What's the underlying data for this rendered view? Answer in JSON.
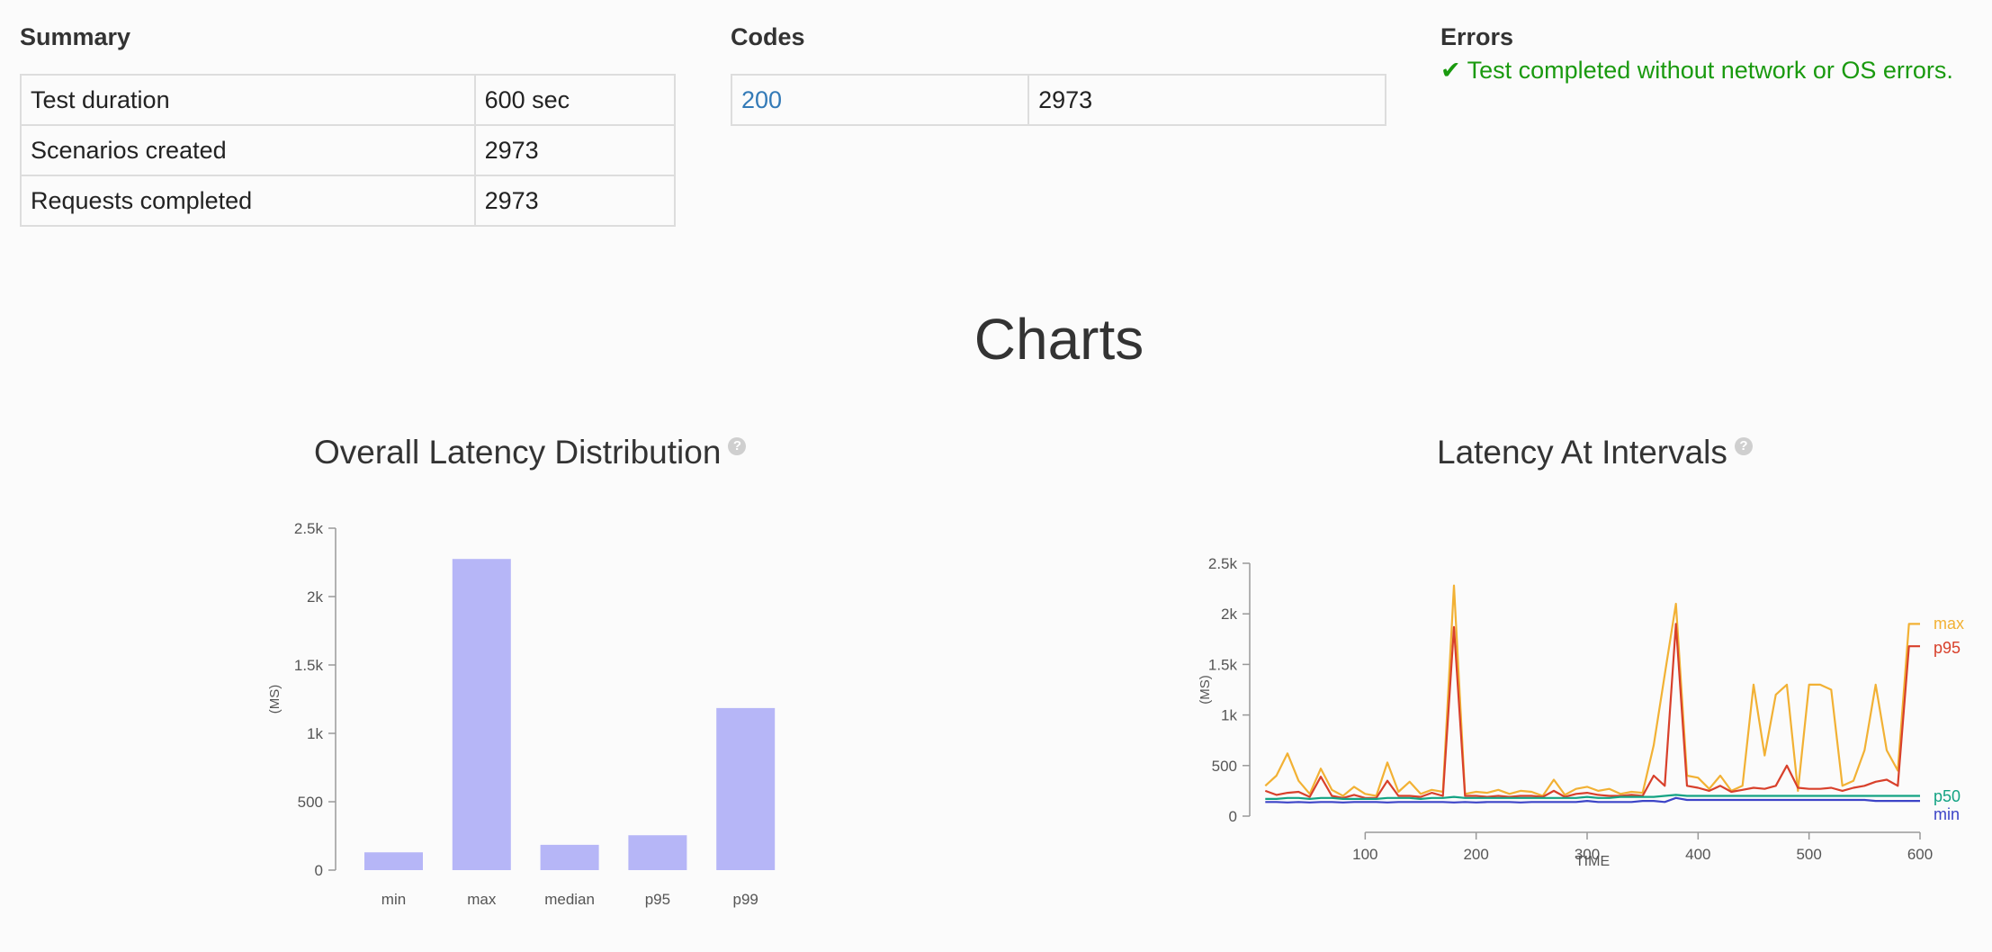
{
  "summary": {
    "heading": "Summary",
    "rows": [
      {
        "label": "Test duration",
        "value": "600 sec"
      },
      {
        "label": "Scenarios created",
        "value": "2973"
      },
      {
        "label": "Requests completed",
        "value": "2973"
      }
    ]
  },
  "codes": {
    "heading": "Codes",
    "rows": [
      {
        "code": "200",
        "count": "2973"
      }
    ]
  },
  "errors": {
    "heading": "Errors",
    "message": "✔ Test completed without network or OS errors."
  },
  "charts_heading": "Charts",
  "icons": {
    "help": "question-icon"
  },
  "colors": {
    "bar": "#b6b6f7",
    "max": "#f2b134",
    "p95": "#d8402b",
    "p50": "#13a383",
    "min": "#3c44c7",
    "success": "#1a9a0f",
    "link": "#337ab7"
  },
  "chart_data": [
    {
      "type": "bar",
      "title": "Overall Latency Distribution",
      "ylabel": "(MS)",
      "categories": [
        "min",
        "max",
        "median",
        "p95",
        "p99"
      ],
      "values": [
        130,
        2275,
        185,
        255,
        1185
      ],
      "ylim": [
        0,
        2500
      ],
      "yticks": [
        {
          "value": 0,
          "label": "0"
        },
        {
          "value": 500,
          "label": "500"
        },
        {
          "value": 1000,
          "label": "1k"
        },
        {
          "value": 1500,
          "label": "1.5k"
        },
        {
          "value": 2000,
          "label": "2k"
        },
        {
          "value": 2500,
          "label": "2.5k"
        }
      ],
      "grid": false
    },
    {
      "type": "line",
      "title": "Latency At Intervals",
      "xlabel": "TIME",
      "ylabel": "(MS)",
      "xlim": [
        0,
        600
      ],
      "ylim": [
        0,
        2500
      ],
      "xticks": [
        {
          "value": 100,
          "label": "100"
        },
        {
          "value": 200,
          "label": "200"
        },
        {
          "value": 300,
          "label": "300"
        },
        {
          "value": 400,
          "label": "400"
        },
        {
          "value": 500,
          "label": "500"
        },
        {
          "value": 600,
          "label": "600"
        }
      ],
      "yticks": [
        {
          "value": 0,
          "label": "0"
        },
        {
          "value": 500,
          "label": "500"
        },
        {
          "value": 1000,
          "label": "1k"
        },
        {
          "value": 1500,
          "label": "1.5k"
        },
        {
          "value": 2000,
          "label": "2k"
        },
        {
          "value": 2500,
          "label": "2.5k"
        }
      ],
      "legend_placement": "right",
      "grid": false,
      "x": [
        10,
        20,
        30,
        40,
        50,
        60,
        70,
        80,
        90,
        100,
        110,
        120,
        130,
        140,
        150,
        160,
        170,
        180,
        190,
        200,
        210,
        220,
        230,
        240,
        250,
        260,
        270,
        280,
        290,
        300,
        310,
        320,
        330,
        340,
        350,
        360,
        370,
        380,
        390,
        400,
        410,
        420,
        430,
        440,
        450,
        460,
        470,
        480,
        490,
        500,
        510,
        520,
        530,
        540,
        550,
        560,
        570,
        580,
        590,
        600
      ],
      "series": [
        {
          "name": "max",
          "values": [
            300,
            400,
            620,
            350,
            220,
            470,
            260,
            200,
            290,
            220,
            200,
            530,
            240,
            340,
            220,
            260,
            240,
            2280,
            220,
            240,
            230,
            260,
            220,
            250,
            240,
            200,
            360,
            210,
            270,
            290,
            250,
            270,
            220,
            240,
            230,
            700,
            1400,
            2100,
            400,
            380,
            270,
            400,
            250,
            300,
            1300,
            600,
            1200,
            1300,
            250,
            1300,
            1300,
            1250,
            300,
            350,
            650,
            1300,
            650,
            450,
            1900,
            1900
          ]
        },
        {
          "name": "p95",
          "values": [
            250,
            210,
            230,
            240,
            190,
            390,
            200,
            180,
            210,
            180,
            180,
            350,
            200,
            200,
            190,
            230,
            200,
            1870,
            200,
            200,
            190,
            200,
            190,
            200,
            200,
            190,
            250,
            190,
            220,
            230,
            210,
            200,
            200,
            210,
            200,
            400,
            300,
            1900,
            300,
            280,
            250,
            300,
            240,
            260,
            280,
            270,
            300,
            500,
            280,
            270,
            270,
            280,
            250,
            280,
            300,
            340,
            360,
            300,
            1680,
            1680
          ]
        },
        {
          "name": "p50",
          "values": [
            170,
            170,
            180,
            180,
            170,
            180,
            180,
            170,
            170,
            170,
            170,
            180,
            180,
            180,
            170,
            180,
            180,
            190,
            180,
            180,
            180,
            180,
            180,
            180,
            180,
            180,
            180,
            180,
            180,
            190,
            180,
            180,
            190,
            190,
            190,
            190,
            200,
            210,
            200,
            200,
            200,
            200,
            200,
            200,
            200,
            200,
            200,
            200,
            200,
            200,
            200,
            200,
            200,
            200,
            200,
            200,
            200,
            200,
            200,
            200
          ]
        },
        {
          "name": "min",
          "values": [
            140,
            140,
            135,
            140,
            135,
            140,
            140,
            135,
            140,
            140,
            140,
            135,
            140,
            140,
            140,
            140,
            140,
            135,
            140,
            135,
            140,
            140,
            140,
            135,
            140,
            140,
            140,
            140,
            140,
            150,
            140,
            140,
            140,
            140,
            150,
            150,
            140,
            180,
            160,
            160,
            160,
            160,
            160,
            160,
            160,
            160,
            160,
            160,
            160,
            160,
            160,
            160,
            160,
            160,
            160,
            150,
            150,
            150,
            150,
            150
          ]
        }
      ]
    }
  ]
}
